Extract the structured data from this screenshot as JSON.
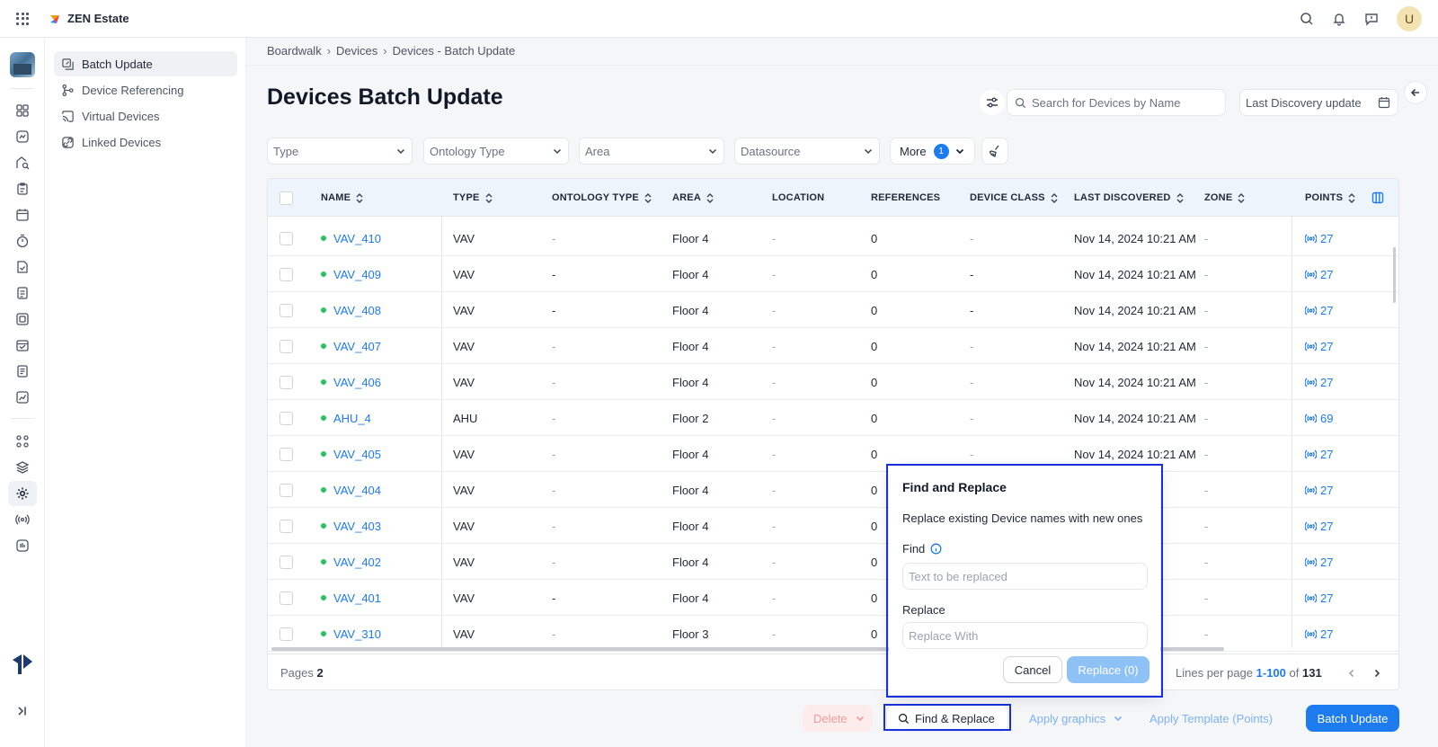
{
  "app": {
    "name": "ZEN Estate",
    "user_initial": "U"
  },
  "subnav": {
    "items": [
      {
        "label": "Batch Update",
        "active": true
      },
      {
        "label": "Device Referencing",
        "active": false
      },
      {
        "label": "Virtual Devices",
        "active": false
      },
      {
        "label": "Linked Devices",
        "active": false
      }
    ]
  },
  "breadcrumb": {
    "items": [
      "Boardwalk",
      "Devices",
      "Devices - Batch Update"
    ]
  },
  "page": {
    "title": "Devices Batch Update"
  },
  "search": {
    "placeholder": "Search for Devices by Name"
  },
  "date_filter": {
    "placeholder": "Last Discovery update"
  },
  "filters": {
    "type": "Type",
    "ontology_type": "Ontology Type",
    "area": "Area",
    "datasource": "Datasource",
    "more_label": "More",
    "more_count": "1"
  },
  "table": {
    "columns": [
      "NAME",
      "TYPE",
      "ONTOLOGY TYPE",
      "AREA",
      "LOCATION",
      "REFERENCES",
      "DEVICE CLASS",
      "LAST DISCOVERED",
      "ZONE",
      "POINTS"
    ],
    "rows": [
      {
        "name": "VAV_410",
        "type": "VAV",
        "ontology": "-",
        "area": "Floor 4",
        "location": "-",
        "references": "0",
        "device_class": "-",
        "last_discovered": "Nov 14, 2024 10:21 AM",
        "zone": "-",
        "points": "27"
      },
      {
        "name": "VAV_409",
        "type": "VAV",
        "ontology": "-",
        "area": "Floor 4",
        "location": "-",
        "references": "0",
        "device_class": "-",
        "last_discovered": "Nov 14, 2024 10:21 AM",
        "zone": "-",
        "points": "27"
      },
      {
        "name": "VAV_408",
        "type": "VAV",
        "ontology": "-",
        "area": "Floor 4",
        "location": "-",
        "references": "0",
        "device_class": "-",
        "last_discovered": "Nov 14, 2024 10:21 AM",
        "zone": "-",
        "points": "27"
      },
      {
        "name": "VAV_407",
        "type": "VAV",
        "ontology": "-",
        "area": "Floor 4",
        "location": "-",
        "references": "0",
        "device_class": "-",
        "last_discovered": "Nov 14, 2024 10:21 AM",
        "zone": "-",
        "points": "27"
      },
      {
        "name": "VAV_406",
        "type": "VAV",
        "ontology": "-",
        "area": "Floor 4",
        "location": "-",
        "references": "0",
        "device_class": "-",
        "last_discovered": "Nov 14, 2024 10:21 AM",
        "zone": "-",
        "points": "27"
      },
      {
        "name": "AHU_4",
        "type": "AHU",
        "ontology": "-",
        "area": "Floor 2",
        "location": "-",
        "references": "0",
        "device_class": "-",
        "last_discovered": "Nov 14, 2024 10:21 AM",
        "zone": "-",
        "points": "69"
      },
      {
        "name": "VAV_405",
        "type": "VAV",
        "ontology": "-",
        "area": "Floor 4",
        "location": "-",
        "references": "0",
        "device_class": "-",
        "last_discovered": "Nov 14, 2024 10:21 AM",
        "zone": "-",
        "points": "27"
      },
      {
        "name": "VAV_404",
        "type": "VAV",
        "ontology": "-",
        "area": "Floor 4",
        "location": "-",
        "references": "0",
        "device_class": "",
        "last_discovered": "21 AM",
        "zone": "-",
        "points": "27"
      },
      {
        "name": "VAV_403",
        "type": "VAV",
        "ontology": "-",
        "area": "Floor 4",
        "location": "-",
        "references": "0",
        "device_class": "",
        "last_discovered": "21 AM",
        "zone": "-",
        "points": "27"
      },
      {
        "name": "VAV_402",
        "type": "VAV",
        "ontology": "-",
        "area": "Floor 4",
        "location": "-",
        "references": "0",
        "device_class": "",
        "last_discovered": "21 AM",
        "zone": "-",
        "points": "27"
      },
      {
        "name": "VAV_401",
        "type": "VAV",
        "ontology": "-",
        "area": "Floor 4",
        "location": "-",
        "references": "0",
        "device_class": "",
        "last_discovered": "21 AM",
        "zone": "-",
        "points": "27"
      },
      {
        "name": "VAV_310",
        "type": "VAV",
        "ontology": "-",
        "area": "Floor 3",
        "location": "-",
        "references": "0",
        "device_class": "",
        "last_discovered": "21 AM",
        "zone": "-",
        "points": "27"
      }
    ],
    "footer": {
      "pages_label": "Pages",
      "pages_value": "2",
      "lines_label": "Lines per page",
      "range": "1-100",
      "of": "of",
      "total": "131"
    }
  },
  "actions": {
    "delete": "Delete",
    "find_replace": "Find & Replace",
    "apply_graphics": "Apply graphics",
    "apply_template": "Apply Template (Points)",
    "batch_update": "Batch Update"
  },
  "popup": {
    "title": "Find and Replace",
    "description": "Replace existing Device names with new ones",
    "find_label": "Find",
    "find_placeholder": "Text to be replaced",
    "replace_label": "Replace",
    "replace_placeholder": "Replace With",
    "cancel": "Cancel",
    "replace_button": "Replace (0)"
  },
  "colors": {
    "accent": "#1d7bf0",
    "status_online": "#22c55e",
    "highlight": "#1a2fdc"
  }
}
